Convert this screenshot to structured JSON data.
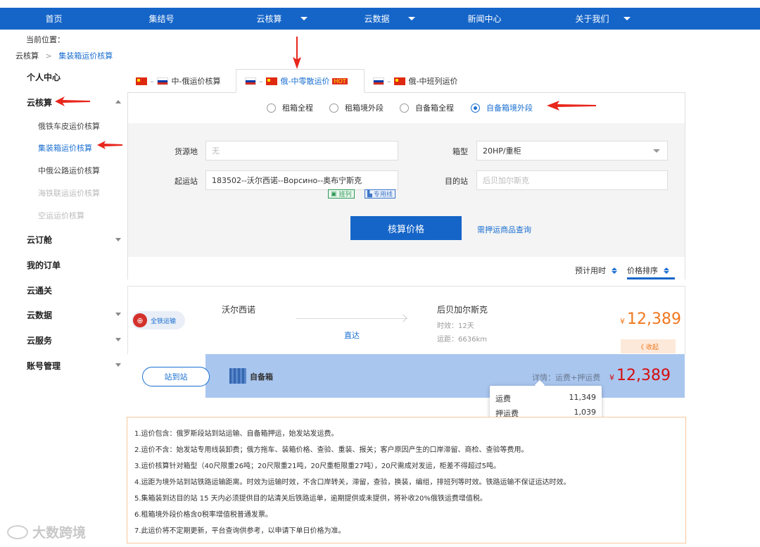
{
  "nav": {
    "items": [
      {
        "label": "首页",
        "has_caret": false
      },
      {
        "label": "集结号",
        "has_caret": false
      },
      {
        "label": "云核算",
        "has_caret": true
      },
      {
        "label": "云数据",
        "has_caret": true
      },
      {
        "label": "新闻中心",
        "has_caret": false
      },
      {
        "label": "关于我们",
        "has_caret": true
      }
    ],
    "color": "#1565c8"
  },
  "breadcrumb": {
    "label": "当前位置：",
    "root": "云核算",
    "sep": ">",
    "current": "集装箱运价核算"
  },
  "sidebar": {
    "items": [
      {
        "label": "个人中心"
      },
      {
        "label": "云核算",
        "expanded": true
      },
      {
        "label": "云订舱"
      },
      {
        "label": "我的订单"
      },
      {
        "label": "云通关"
      },
      {
        "label": "云数据"
      },
      {
        "label": "云服务"
      },
      {
        "label": "账号管理"
      }
    ],
    "subitems": [
      {
        "label": "俄铁车皮运价核算",
        "state": "normal"
      },
      {
        "label": "集装箱运价核算",
        "state": "active"
      },
      {
        "label": "中俄公路运价核算",
        "state": "normal"
      },
      {
        "label": "海铁联运运价核算",
        "state": "disabled"
      },
      {
        "label": "空运运价核算",
        "state": "disabled"
      }
    ]
  },
  "tabs": [
    {
      "label": "中-俄运价核算",
      "flags": [
        "cn",
        "ru"
      ],
      "active": false
    },
    {
      "label": "俄-中零散运价",
      "flags": [
        "ru",
        "cn"
      ],
      "active": true,
      "badge": "HOT"
    },
    {
      "label": "俄-中班列运价",
      "flags": [
        "ru",
        "cn"
      ],
      "active": false
    }
  ],
  "radios": [
    {
      "label": "租箱全程",
      "selected": false
    },
    {
      "label": "租箱境外段",
      "selected": false
    },
    {
      "label": "自备箱全程",
      "selected": false
    },
    {
      "label": "自备箱境外段",
      "selected": true
    }
  ],
  "form": {
    "origin_label": "货源地",
    "origin_placeholder": "无",
    "box_type_label": "箱型",
    "box_type_value": "20HP/重柜",
    "start_label": "起运站",
    "start_value": "183502--沃尔西诺--Ворсино--奥布宁斯克",
    "dest_label": "目的站",
    "dest_placeholder": "后贝加尔斯克",
    "tag1": "班列",
    "tag2": "专用线",
    "calc_button": "核算价格",
    "query_link": "需押运商品查询"
  },
  "sort": {
    "time_label": "预计用时",
    "price_label": "价格排序"
  },
  "result": {
    "badge": "全铁运输",
    "from": "沃尔西诺",
    "to": "后贝加尔斯克",
    "route_type": "直达",
    "duration": "时效：12天",
    "distance": "运距：6636km",
    "currency": "¥",
    "price": "12,389",
    "collapse": "《 收起",
    "station_button": "站到站",
    "container_label": "自备箱",
    "detail_label": "详情：运费+押运费",
    "total_price": "12,389",
    "tooltip": [
      {
        "label": "运费",
        "value": "11,349"
      },
      {
        "label": "押运费",
        "value": "1,039"
      }
    ]
  },
  "notes": [
    "1.运价包含：俄罗斯段站到站运输、自备箱押运，始发站发运费。",
    "2.运价不含：始发站专用线装卸费；俄方拖车、装箱价格、查验、重装、报关；客户原因产生的口岸滞留、商检、查验等费用。",
    "3.运价核算针对箱型（40尺限重26吨；20尺限重21吨，20尺重柜限重27吨），20尺需成对发运，柜差不得超过5吨。",
    "4.运距为境外站到站铁路运输距离。时效为运输时效，不含口岸转关，滞留，查验，换装，编组，排班列等时效。铁路运输不保证运达时效。",
    "5.集箱装到达目的站 15 天内必须提供目的站清关后铁路运单，逾期提供或未提供，将补收20%俄铁运费增值税。",
    "6.租箱境外段价格含0税率增值税普通发票。",
    "7.此运价将不定期更新，平台查询供参考，以申请下单日价格为准。"
  ],
  "watermark": "大数跨境",
  "colors": {
    "accent": "#1565c8",
    "price_orange": "#f07820",
    "price_red": "#d40e0e",
    "arrow_red": "#e8261c"
  }
}
